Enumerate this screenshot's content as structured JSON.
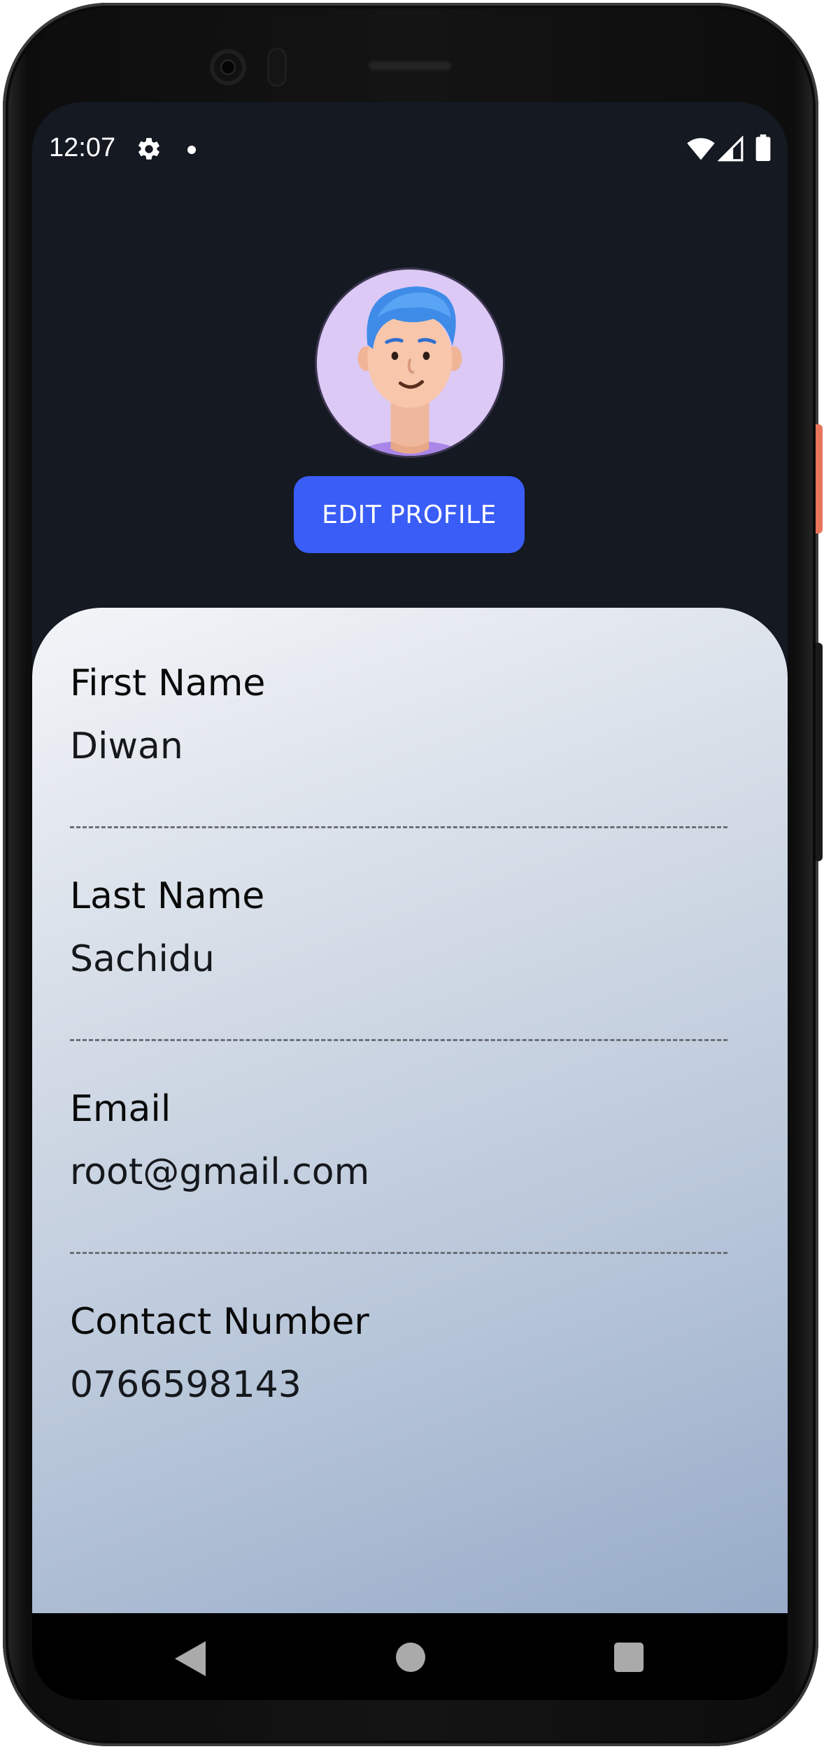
{
  "status_bar": {
    "time": "12:07",
    "icons": [
      "gear-icon",
      "notification-dot-icon",
      "wifi-icon",
      "signal-icon",
      "battery-icon"
    ]
  },
  "profile": {
    "avatar_icon": "avatar-icon",
    "edit_button_label": "EDIT PROFILE"
  },
  "fields": [
    {
      "label": "First Name",
      "value": "Diwan"
    },
    {
      "label": "Last Name",
      "value": "Sachidu"
    },
    {
      "label": "Email",
      "value": "root@gmail.com"
    },
    {
      "label": "Contact Number",
      "value": "0766598143"
    }
  ],
  "nav_bar": {
    "icons": [
      "back-icon",
      "home-icon",
      "recents-icon"
    ]
  },
  "colors": {
    "screen_background": "#141922",
    "accent": "#3a5cf7",
    "avatar_background": "#dcc9f5",
    "card_gradient_start": "#f3f5f8",
    "card_gradient_end": "#97abc8"
  }
}
